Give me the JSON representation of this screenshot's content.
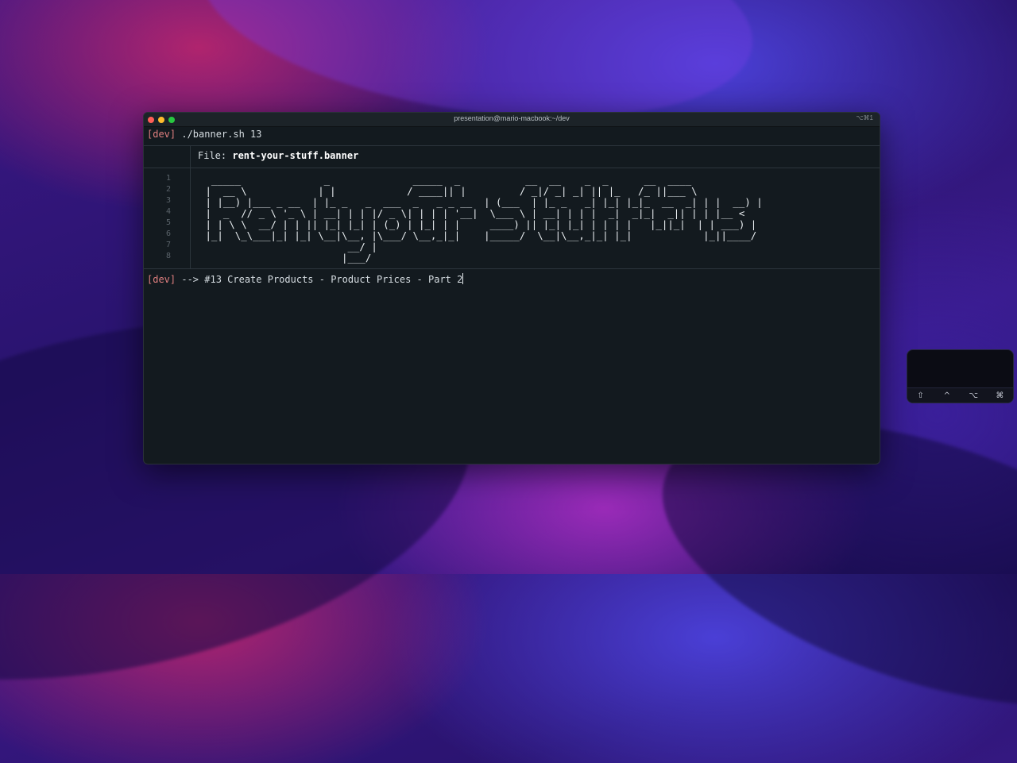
{
  "window": {
    "title": "presentation@mario-macbook:~/dev",
    "shortcut": "⌥⌘1"
  },
  "terminal": {
    "prompt": "[dev]",
    "command1": " ./banner.sh 13",
    "file_label": "File: ",
    "file_name": "rent-your-stuff.banner",
    "line_numbers": [
      "1",
      "2",
      "3",
      "4",
      "5",
      "6",
      "7",
      "8"
    ],
    "banner_ascii": "  _____              _              _____  _           __  __    _  _      __  ____  \n |  __ \\            | |            / ____|| |         / _|/ _| _| || |_   /_ ||___ \\ \n | |__) |___ _ __  | |_ _   _  ___  _   _ _ __  | (___  | |_ _   _| |_| |_|_  __  _| | |  __) |\n |  _  // _ \\ '_ \\ | __| | | |/ _ \\| | | | '__|  \\___ \\ | __| | | |  _|  _|_|  _|| | | |__ < \n | | \\ \\  __/ | | || |_| |_| | (_) | |_| | |     ____) || |_| |_| | | | |   |_||_|  | | ___) |\n |_|  \\_\\___|_| |_| \\__|\\__, |\\___/ \\__,_|_|    |_____/  \\__|\\__,_|_| |_|            |_||____/ \n                         __/ |\n                        |___/",
    "command2": " --> #13 Create Products - Product Prices - Part 2"
  },
  "modifier_keys": [
    "⇧",
    "^",
    "⌥",
    "⌘"
  ]
}
